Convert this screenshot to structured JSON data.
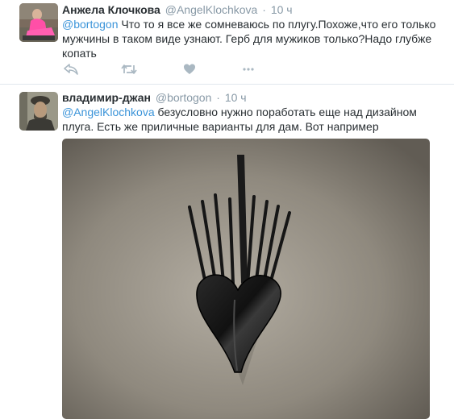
{
  "tweets": [
    {
      "fullname": "Анжела Клочкова",
      "handle": "@AngelKlochkova",
      "dot": "·",
      "time": "10 ч",
      "mention": "@bortogon",
      "text": " Что то я все же сомневаюсь по плугу.Похоже,что его только мужчины в таком виде узнают. Герб для мужиков только?Надо глубже копать",
      "actions": [
        "reply-icon",
        "retweet-icon",
        "like-icon",
        "more-icon"
      ]
    },
    {
      "fullname": "владимир-джан",
      "handle": "@bortogon",
      "dot": "·",
      "time": "10 ч",
      "mention": "@AngelKlochkova",
      "text": " безусловно нужно поработать еще над дизайном плуга. Есть же приличные варианты для дам. Вот например",
      "photo": "heart-shaped-plow-photo"
    }
  ],
  "colors": {
    "mention": "#3b94d9",
    "meta": "#8899a6",
    "icons": "#aab8c2",
    "separator": "#e1e8ed"
  }
}
